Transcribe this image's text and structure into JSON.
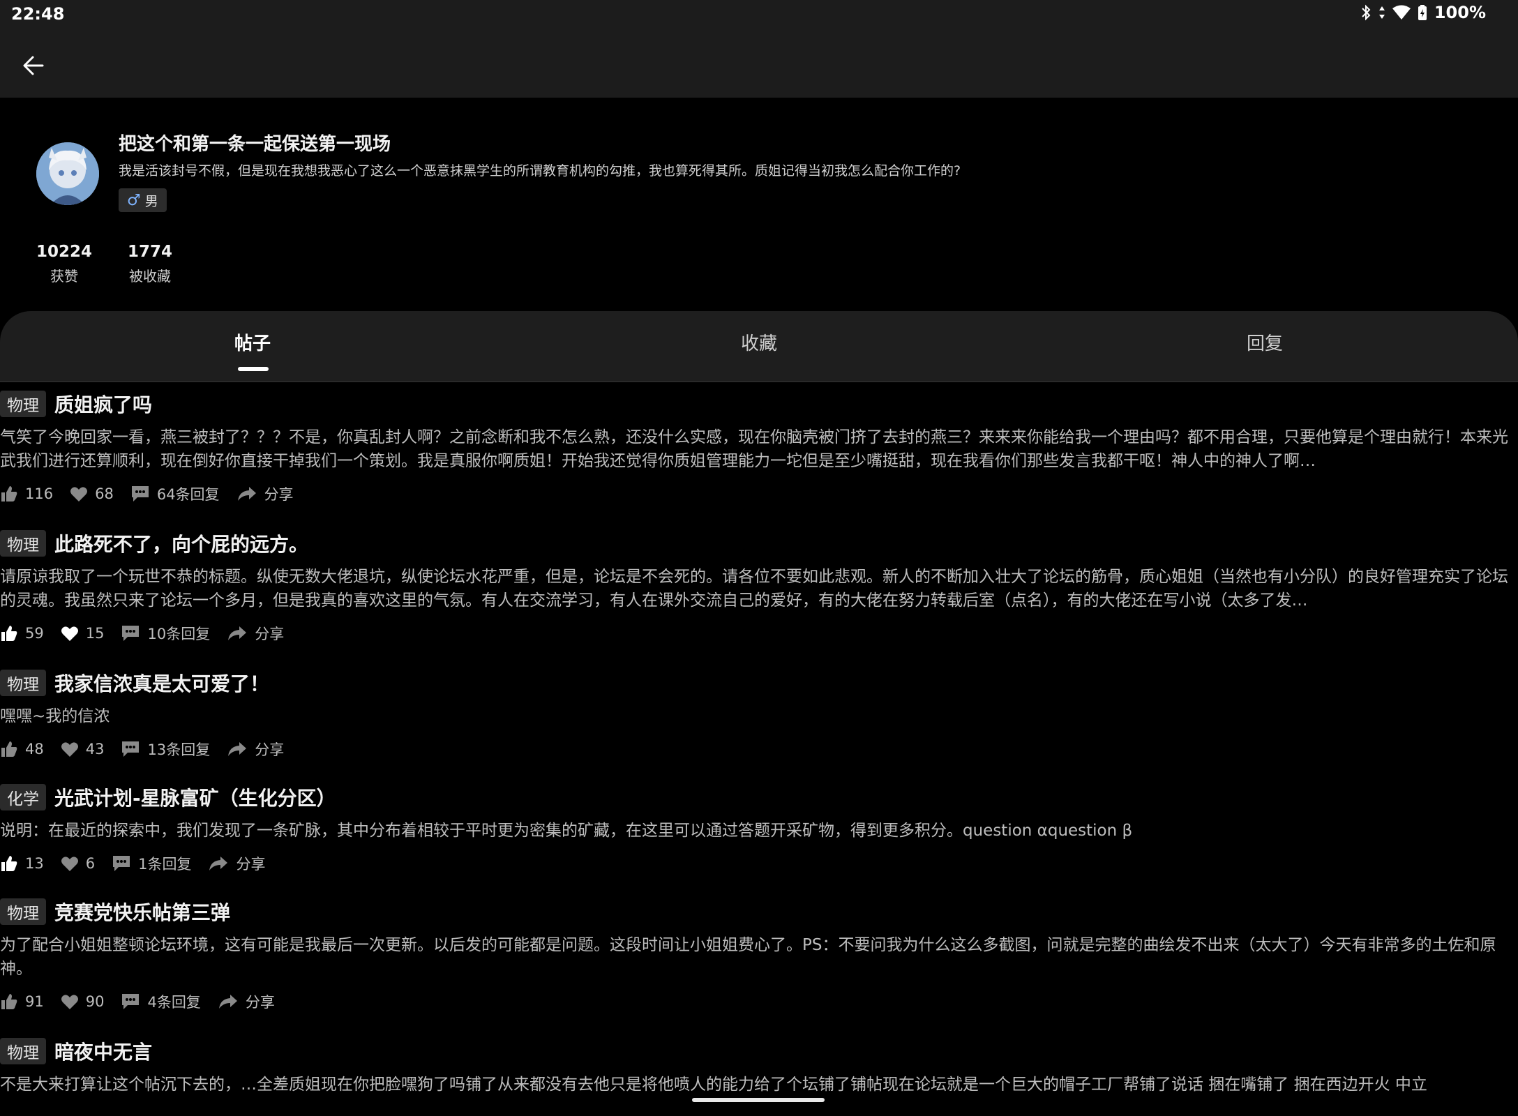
{
  "status": {
    "time": "22:48",
    "battery": "100%"
  },
  "profile": {
    "name": "把这个和第一条一起保送第一现场",
    "bio": "我是活该封号不假，但是现在我想我恶心了这么一个恶意抹黑学生的所谓教育机构的勾推，我也算死得其所。质姐记得当初我怎么配合你工作的?",
    "gender_symbol": "♂",
    "gender": "男",
    "stats": [
      {
        "value": "10224",
        "label": "获赞"
      },
      {
        "value": "1774",
        "label": "被收藏"
      }
    ]
  },
  "tabs": [
    {
      "label": "帖子",
      "active": true
    },
    {
      "label": "收藏",
      "active": false
    },
    {
      "label": "回复",
      "active": false
    }
  ],
  "share_label": "分享",
  "posts": [
    {
      "tag": "物理",
      "title": "质姐疯了吗",
      "body": "气笑了今晚回家一看，燕三被封了？？？不是，你真乱封人啊？之前念断和我不怎么熟，还没什么实感，现在你脑壳被门挤了去封的燕三？来来来你能给我一个理由吗？都不用合理，只要他算是个理由就行！本来光武我们进行还算顺利，现在倒好你直接干掉我们一个策划。我是真服你啊质姐！开始我还觉得你质姐管理能力一坨但是至少嘴挺甜，现在我看你们那些发言我都干呕！神人中的神人了啊…",
      "likes": "116",
      "favs": "68",
      "replies": "64条回复"
    },
    {
      "tag": "物理",
      "title": "此路死不了，向个屁的远方。",
      "body": "请原谅我取了一个玩世不恭的标题。纵使无数大佬退坑，纵使论坛水花严重，但是，论坛是不会死的。请各位不要如此悲观。新人的不断加入壮大了论坛的筋骨，质心姐姐（当然也有小分队）的良好管理充实了论坛的灵魂。我虽然只来了论坛一个多月，但是我真的喜欢这里的气氛。有人在交流学习，有人在课外交流自己的爱好，有的大佬在努力转载后室（点名），有的大佬还在写小说（太多了发…",
      "likes": "59",
      "favs": "15",
      "replies": "10条回复"
    },
    {
      "tag": "物理",
      "title": "我家信浓真是太可爱了！",
      "body": "嘿嘿~我的信浓",
      "likes": "48",
      "favs": "43",
      "replies": "13条回复"
    },
    {
      "tag": "化学",
      "title": "光武计划-星脉富矿（生化分区）",
      "body": "说明：在最近的探索中，我们发现了一条矿脉，其中分布着相较于平时更为密集的矿藏，在这里可以通过答题开采矿物，得到更多积分。question αquestion β",
      "likes": "13",
      "favs": "6",
      "replies": "1条回复"
    },
    {
      "tag": "物理",
      "title": "竞赛党快乐帖第三弹",
      "body": "为了配合小姐姐整顿论坛环境，这有可能是我最后一次更新。以后发的可能都是问题。这段时间让小姐姐费心了。PS：不要问我为什么这么多截图，问就是完整的曲绘发不出来（太大了）今天有非常多的土佐和原神。",
      "likes": "91",
      "favs": "90",
      "replies": "4条回复"
    },
    {
      "tag": "物理",
      "title": "暗夜中无言",
      "body": "不是大来打算让这个帖沉下去的，…全差质姐现在你把脸嘿狗了吗铺了从来都没有去他只是将他喷人的能力给了个坛铺了铺帖现在论坛就是一个巨大的帽子工厂帮铺了说话 捆在嘴铺了 捆在西边开火 中立",
      "likes": "",
      "favs": "",
      "replies": ""
    }
  ]
}
